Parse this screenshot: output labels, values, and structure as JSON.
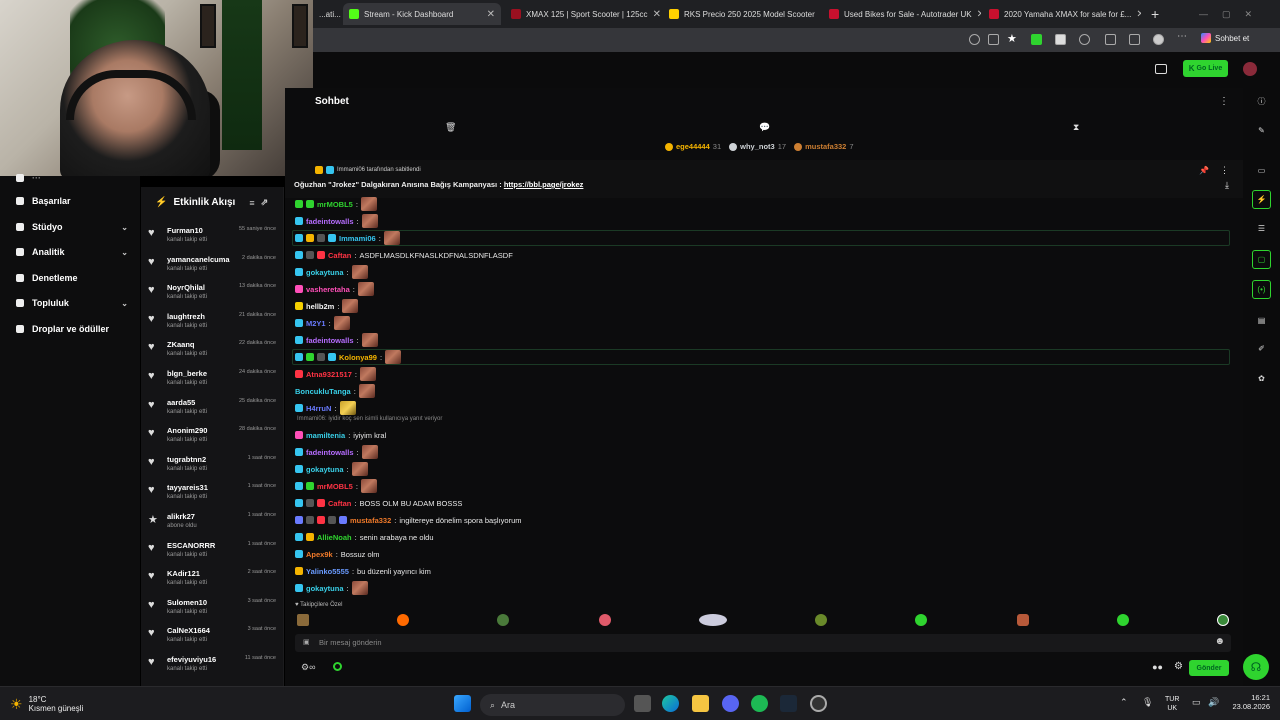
{
  "browser": {
    "tabs": [
      {
        "label": "...ati...",
        "color": "#888888",
        "active": false
      },
      {
        "label": "Stream - Kick Dashboard",
        "color": "#53fc18",
        "active": true
      },
      {
        "label": "XMAX 125 | Sport Scooter | 125cc",
        "color": "#9a1020",
        "active": false
      },
      {
        "label": "RKS Precio 250 2025 Model Scooter",
        "color": "#ffd000",
        "active": false
      },
      {
        "label": "Used Bikes for Sale - Autotrader UK",
        "color": "#c8102e",
        "active": false
      },
      {
        "label": "2020 Yamaha XMAX for sale for £...",
        "color": "#c8102e",
        "active": false
      }
    ],
    "profile_label": "Sohbet et"
  },
  "kick_top": {
    "go_live": "Go Live"
  },
  "left_nav": {
    "items": [
      {
        "label": "Başarılar",
        "icon": "trophy-icon",
        "has_chevron": false
      },
      {
        "label": "Stüdyo",
        "icon": "studio-icon",
        "has_chevron": true
      },
      {
        "label": "Analitik",
        "icon": "chart-icon",
        "has_chevron": true
      },
      {
        "label": "Denetleme",
        "icon": "wrench-icon",
        "has_chevron": false
      },
      {
        "label": "Topluluk",
        "icon": "community-icon",
        "has_chevron": true
      },
      {
        "label": "Droplar ve ödüller",
        "icon": "gift-icon",
        "has_chevron": false
      }
    ]
  },
  "activity": {
    "title": "Etkinlik Akışı",
    "rows": [
      {
        "user": "Furman10",
        "action": "kanalı takip etti",
        "time": "55 saniye önce",
        "icon": "♥"
      },
      {
        "user": "yamancanelcuma",
        "action": "kanalı takip etti",
        "time": "2 dakika önce",
        "icon": "♥"
      },
      {
        "user": "NoyrQhilal",
        "action": "kanalı takip etti",
        "time": "13 dakika önce",
        "icon": "♥"
      },
      {
        "user": "laughtrezh",
        "action": "kanalı takip etti",
        "time": "21 dakika önce",
        "icon": "♥"
      },
      {
        "user": "ZKaanq",
        "action": "kanalı takip etti",
        "time": "22 dakika önce",
        "icon": "♥"
      },
      {
        "user": "blgn_berke",
        "action": "kanalı takip etti",
        "time": "24 dakika önce",
        "icon": "♥"
      },
      {
        "user": "aarda55",
        "action": "kanalı takip etti",
        "time": "25 dakika önce",
        "icon": "♥"
      },
      {
        "user": "Anonim290",
        "action": "kanalı takip etti",
        "time": "28 dakika önce",
        "icon": "♥"
      },
      {
        "user": "tugrabtnn2",
        "action": "kanalı takip etti",
        "time": "1 saat önce",
        "icon": "♥"
      },
      {
        "user": "tayyareis31",
        "action": "kanalı takip etti",
        "time": "1 saat önce",
        "icon": "♥"
      },
      {
        "user": "alikrk27",
        "action": "abone oldu",
        "time": "1 saat önce",
        "icon": "★"
      },
      {
        "user": "ESCANORRR",
        "action": "kanalı takip etti",
        "time": "1 saat önce",
        "icon": "♥"
      },
      {
        "user": "KAdir121",
        "action": "kanalı takip etti",
        "time": "2 saat önce",
        "icon": "♥"
      },
      {
        "user": "Sulomen10",
        "action": "kanalı takip etti",
        "time": "3 saat önce",
        "icon": "♥"
      },
      {
        "user": "CalNeX1664",
        "action": "kanalı takip etti",
        "time": "3 saat önce",
        "icon": "♥"
      },
      {
        "user": "efeviyuviyu16",
        "action": "kanalı takip etti",
        "time": "11 saat önce",
        "icon": "♥"
      }
    ]
  },
  "chat": {
    "title": "Sohbet",
    "leaderboard": [
      {
        "user": "ege44444",
        "count": "31",
        "color": "#f5b400"
      },
      {
        "user": "why_not3",
        "count": "17",
        "color": "#cfd3d6"
      },
      {
        "user": "mustafa332",
        "count": "7",
        "color": "#cd7f32"
      }
    ],
    "pinned_by": "Immami06 tarafından sabitlendi",
    "pinned_text": "Oğuzhan \"Jrokez\" Dalgakıran Anısına Bağış Kampanyası : ",
    "pinned_link": "https://bbl.page/jrokez",
    "messages": [
      {
        "user": "mrMOBL5",
        "color": "#2fd42f",
        "text": "",
        "emote": true,
        "hl": false
      },
      {
        "user": "fadeintowalls",
        "color": "#b66dff",
        "text": "",
        "emote": true,
        "hl": false
      },
      {
        "user": "Immami06",
        "color": "#36c5f0",
        "text": "",
        "emote": true,
        "hl": true
      },
      {
        "user": "Caftan",
        "color": "#ff3344",
        "text": "ASDFLMASDLKFNASLKDFNALSDNFLASDF",
        "emote": false,
        "hl": false
      },
      {
        "user": "gokaytuna",
        "color": "#39d0e8",
        "text": "",
        "emote": true,
        "hl": false
      },
      {
        "user": "vasheretaha",
        "color": "#ff4fb8",
        "text": "",
        "emote": true,
        "hl": false
      },
      {
        "user": "hellb2m",
        "color": "#f5f5f5",
        "text": "",
        "emote": true,
        "hl": false
      },
      {
        "user": "M2Y1",
        "color": "#6a7bff",
        "text": "",
        "emote": true,
        "hl": false
      },
      {
        "user": "fadeintowalls",
        "color": "#b66dff",
        "text": "",
        "emote": true,
        "hl": false
      },
      {
        "user": "Kolonya99",
        "color": "#f5b400",
        "text": "",
        "emote": true,
        "hl": true
      },
      {
        "user": "Atna9321517",
        "color": "#ff3344",
        "text": "",
        "emote": true,
        "hl": false
      },
      {
        "user": "BoncukluTanga",
        "color": "#39d0e8",
        "text": "",
        "emote": true,
        "hl": false
      },
      {
        "user": "H4rruN",
        "color": "#6a7bff",
        "text": "",
        "emote": true,
        "gold": true,
        "hl": false
      },
      {
        "user": "mamiltenia",
        "color": "#39d0e8",
        "text": "iyiyim kral",
        "emote": false,
        "hl": false,
        "reply": "Immami06: iyidir koç sen isimli kullanıcıya yanıt veriyor"
      },
      {
        "user": "fadeintowalls",
        "color": "#b66dff",
        "text": "",
        "emote": true,
        "hl": false
      },
      {
        "user": "gokaytuna",
        "color": "#39d0e8",
        "text": "",
        "emote": true,
        "hl": false
      },
      {
        "user": "mrMOBL5",
        "color": "#ff3344",
        "text": "",
        "emote": true,
        "hl": false
      },
      {
        "user": "Caftan",
        "color": "#ff3344",
        "text": "BOSS OLM BU ADAM BOSSS",
        "emote": false,
        "hl": false
      },
      {
        "user": "mustafa332",
        "color": "#f07a2a",
        "text": "ingiltereye dönelim spora başlıyorum",
        "emote": false,
        "hl": false
      },
      {
        "user": "AllieNoah",
        "color": "#2fd42f",
        "text": "senin arabaya ne oldu",
        "emote": false,
        "hl": false
      },
      {
        "user": "Apex9k",
        "color": "#f07a2a",
        "text": "Bossuz olm",
        "emote": false,
        "hl": false
      },
      {
        "user": "Yalinko5555",
        "color": "#6a9bff",
        "text": "bu düzenli yayıncı kim",
        "emote": false,
        "hl": false
      },
      {
        "user": "gokaytuna",
        "color": "#39d0e8",
        "text": "",
        "emote": true,
        "hl": false
      }
    ],
    "followers_only": "Takipçilere Özel",
    "input_placeholder": "Bir mesaj gönderin",
    "send_label": "Gönder"
  },
  "taskbar": {
    "temperature": "18°C",
    "weather": "Kısmen güneşli",
    "search_label": "Ara",
    "lang_top": "TUR",
    "lang_bottom": "UK",
    "time": "16:21",
    "date": "23.08.2026"
  }
}
